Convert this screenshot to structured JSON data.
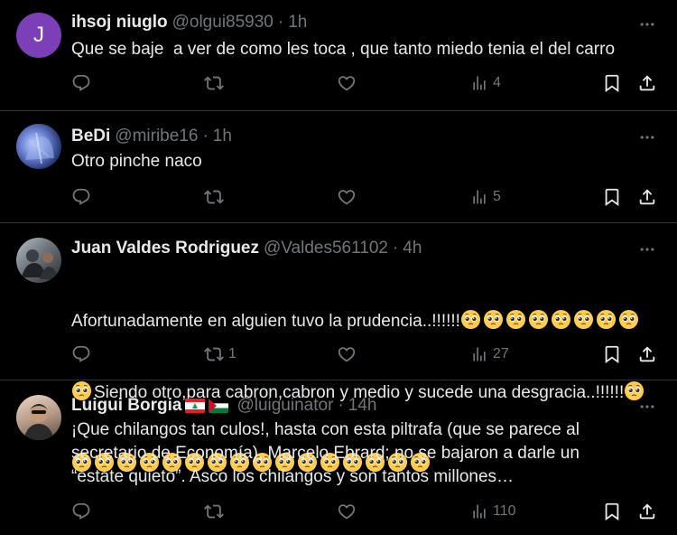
{
  "tweets": [
    {
      "avatar_letter": "J",
      "avatar_color": "#7c3fb8",
      "name": "ihsoj niuglo",
      "handle": "@olgui85930",
      "dot": "·",
      "time": "1h",
      "text": "Que se baje  a ver de como les toca , que tanto miedo tenia el del carro",
      "retweets": "",
      "views": "4"
    },
    {
      "name": "BeDi",
      "handle": "@miribe16",
      "dot": "·",
      "time": "1h",
      "text": "Otro pinche naco",
      "retweets": "",
      "views": "5"
    },
    {
      "name": "Juan Valdes Rodriguez",
      "handle": "@Valdes561102",
      "dot": "·",
      "time": "4h",
      "text_part1": "Afortunadamente en alguien tuvo la prudencia..!!!!!!",
      "text_part2": "Siendo otro,para cabron,cabron y medio y sucede una desgracia..!!!!!!",
      "emoji_name": "pleading-face-emoji",
      "emoji_count_line1": 8,
      "emoji_count_line2_start": 1,
      "emoji_count_line2_end": 1,
      "emoji_count_line3": 16,
      "retweets": "1",
      "views": "27"
    },
    {
      "name": "Luigui Borgia",
      "flags": [
        "lebanon-flag-emoji",
        "palestine-flag-emoji"
      ],
      "handle": "@luiguinator",
      "dot": "·",
      "time": "14h",
      "text": "¡Que chilangos tan culos!, hasta con esta piltrafa (que se parece al secretario de Economía), Marcelo Ebrard; no se bajaron a darle un “estate quieto”. Asco los chilangos y son tantos millones…",
      "retweets": "",
      "views": "110"
    }
  ],
  "icons": {
    "reply": "reply-icon",
    "retweet": "retweet-icon",
    "like": "like-icon",
    "views": "views-icon",
    "bookmark": "bookmark-icon",
    "share": "share-icon",
    "more": "more-icon"
  },
  "colors": {
    "background": "#000000",
    "text": "#e7e9ea",
    "muted": "#71767b",
    "divider": "#2f3336"
  }
}
